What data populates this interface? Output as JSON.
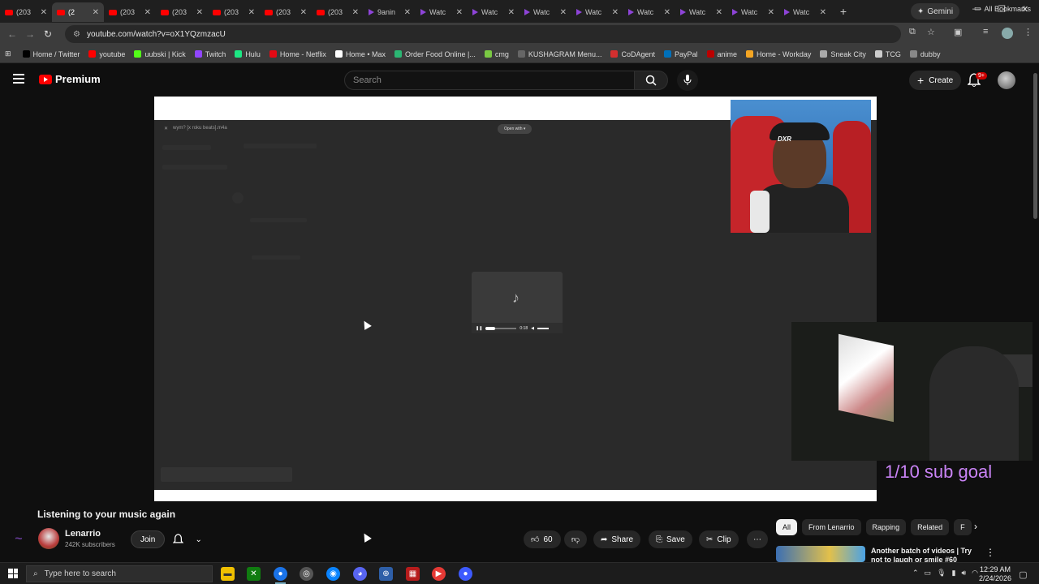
{
  "browser": {
    "tabs": [
      {
        "title": "(203",
        "icon": "youtube-icon"
      },
      {
        "title": "(2",
        "icon": "youtube-icon",
        "active": true
      },
      {
        "title": "(203",
        "icon": "youtube-icon"
      },
      {
        "title": "(203",
        "icon": "youtube-icon"
      },
      {
        "title": "(203",
        "icon": "youtube-icon"
      },
      {
        "title": "(203",
        "icon": "youtube-icon"
      },
      {
        "title": "(203",
        "icon": "youtube-icon"
      },
      {
        "title": "9anin",
        "icon": "play-icon"
      },
      {
        "title": "Watc",
        "icon": "play-icon"
      },
      {
        "title": "Watc",
        "icon": "play-icon"
      },
      {
        "title": "Watc",
        "icon": "play-icon"
      },
      {
        "title": "Watc",
        "icon": "play-icon"
      },
      {
        "title": "Watc",
        "icon": "play-icon"
      },
      {
        "title": "Watc",
        "icon": "play-icon"
      },
      {
        "title": "Watc",
        "icon": "play-icon"
      },
      {
        "title": "Watc",
        "icon": "play-icon"
      }
    ],
    "gemini_label": "Gemini",
    "url": "youtube.com/watch?v=oX1YQzmzacU",
    "bookmarks": [
      {
        "label": "Home / Twitter",
        "color": "#000000"
      },
      {
        "label": "youtube",
        "color": "#ff0000"
      },
      {
        "label": "uubski | Kick",
        "color": "#53fc18"
      },
      {
        "label": "Twitch",
        "color": "#9146ff"
      },
      {
        "label": "Hulu",
        "color": "#1ce783"
      },
      {
        "label": "Home - Netflix",
        "color": "#e50914"
      },
      {
        "label": "Home • Max",
        "color": "#ffffff"
      },
      {
        "label": "Order Food Online |...",
        "color": "#2bb673"
      },
      {
        "label": "cmg",
        "color": "#7ac943"
      },
      {
        "label": "KUSHAGRAM Menu...",
        "color": "#666666"
      },
      {
        "label": "CoDAgent",
        "color": "#d32f2f"
      },
      {
        "label": "PayPal",
        "color": "#0070ba"
      },
      {
        "label": "anime",
        "color": "#bb0000"
      },
      {
        "label": "Home - Workday",
        "color": "#f5a623"
      },
      {
        "label": "Sneak City",
        "color": "#aaaaaa"
      },
      {
        "label": "TCG",
        "color": "#cccccc"
      },
      {
        "label": "dubby",
        "color": "#888888"
      }
    ],
    "all_bookmarks": "All Bookmarks"
  },
  "youtube": {
    "brand": "Premium",
    "search_placeholder": "Search",
    "create_label": "Create",
    "notif_badge": "9+",
    "video": {
      "inner_file_title": "wym? [x roku beats].m4a",
      "inner_open_with": "Open with",
      "inner_time": "0:18",
      "sub_goal": "1/10 sub goal",
      "cam_brand": "DXR"
    },
    "title": "Listening to your music again",
    "channel": {
      "name": "Lenarrio",
      "subs": "242K subscribers",
      "join_label": "Join"
    },
    "actions": {
      "likes": "60",
      "share": "Share",
      "save": "Save",
      "clip": "Clip"
    },
    "chips": [
      "All",
      "From Lenarrio",
      "Rapping",
      "Related",
      "F"
    ],
    "recommendation": {
      "title": "Another batch of videos | Try not to laugh or smile #60"
    }
  },
  "taskbar": {
    "search_placeholder": "Type here to search",
    "time": "12:29 AM",
    "date": "2/24/2026"
  }
}
